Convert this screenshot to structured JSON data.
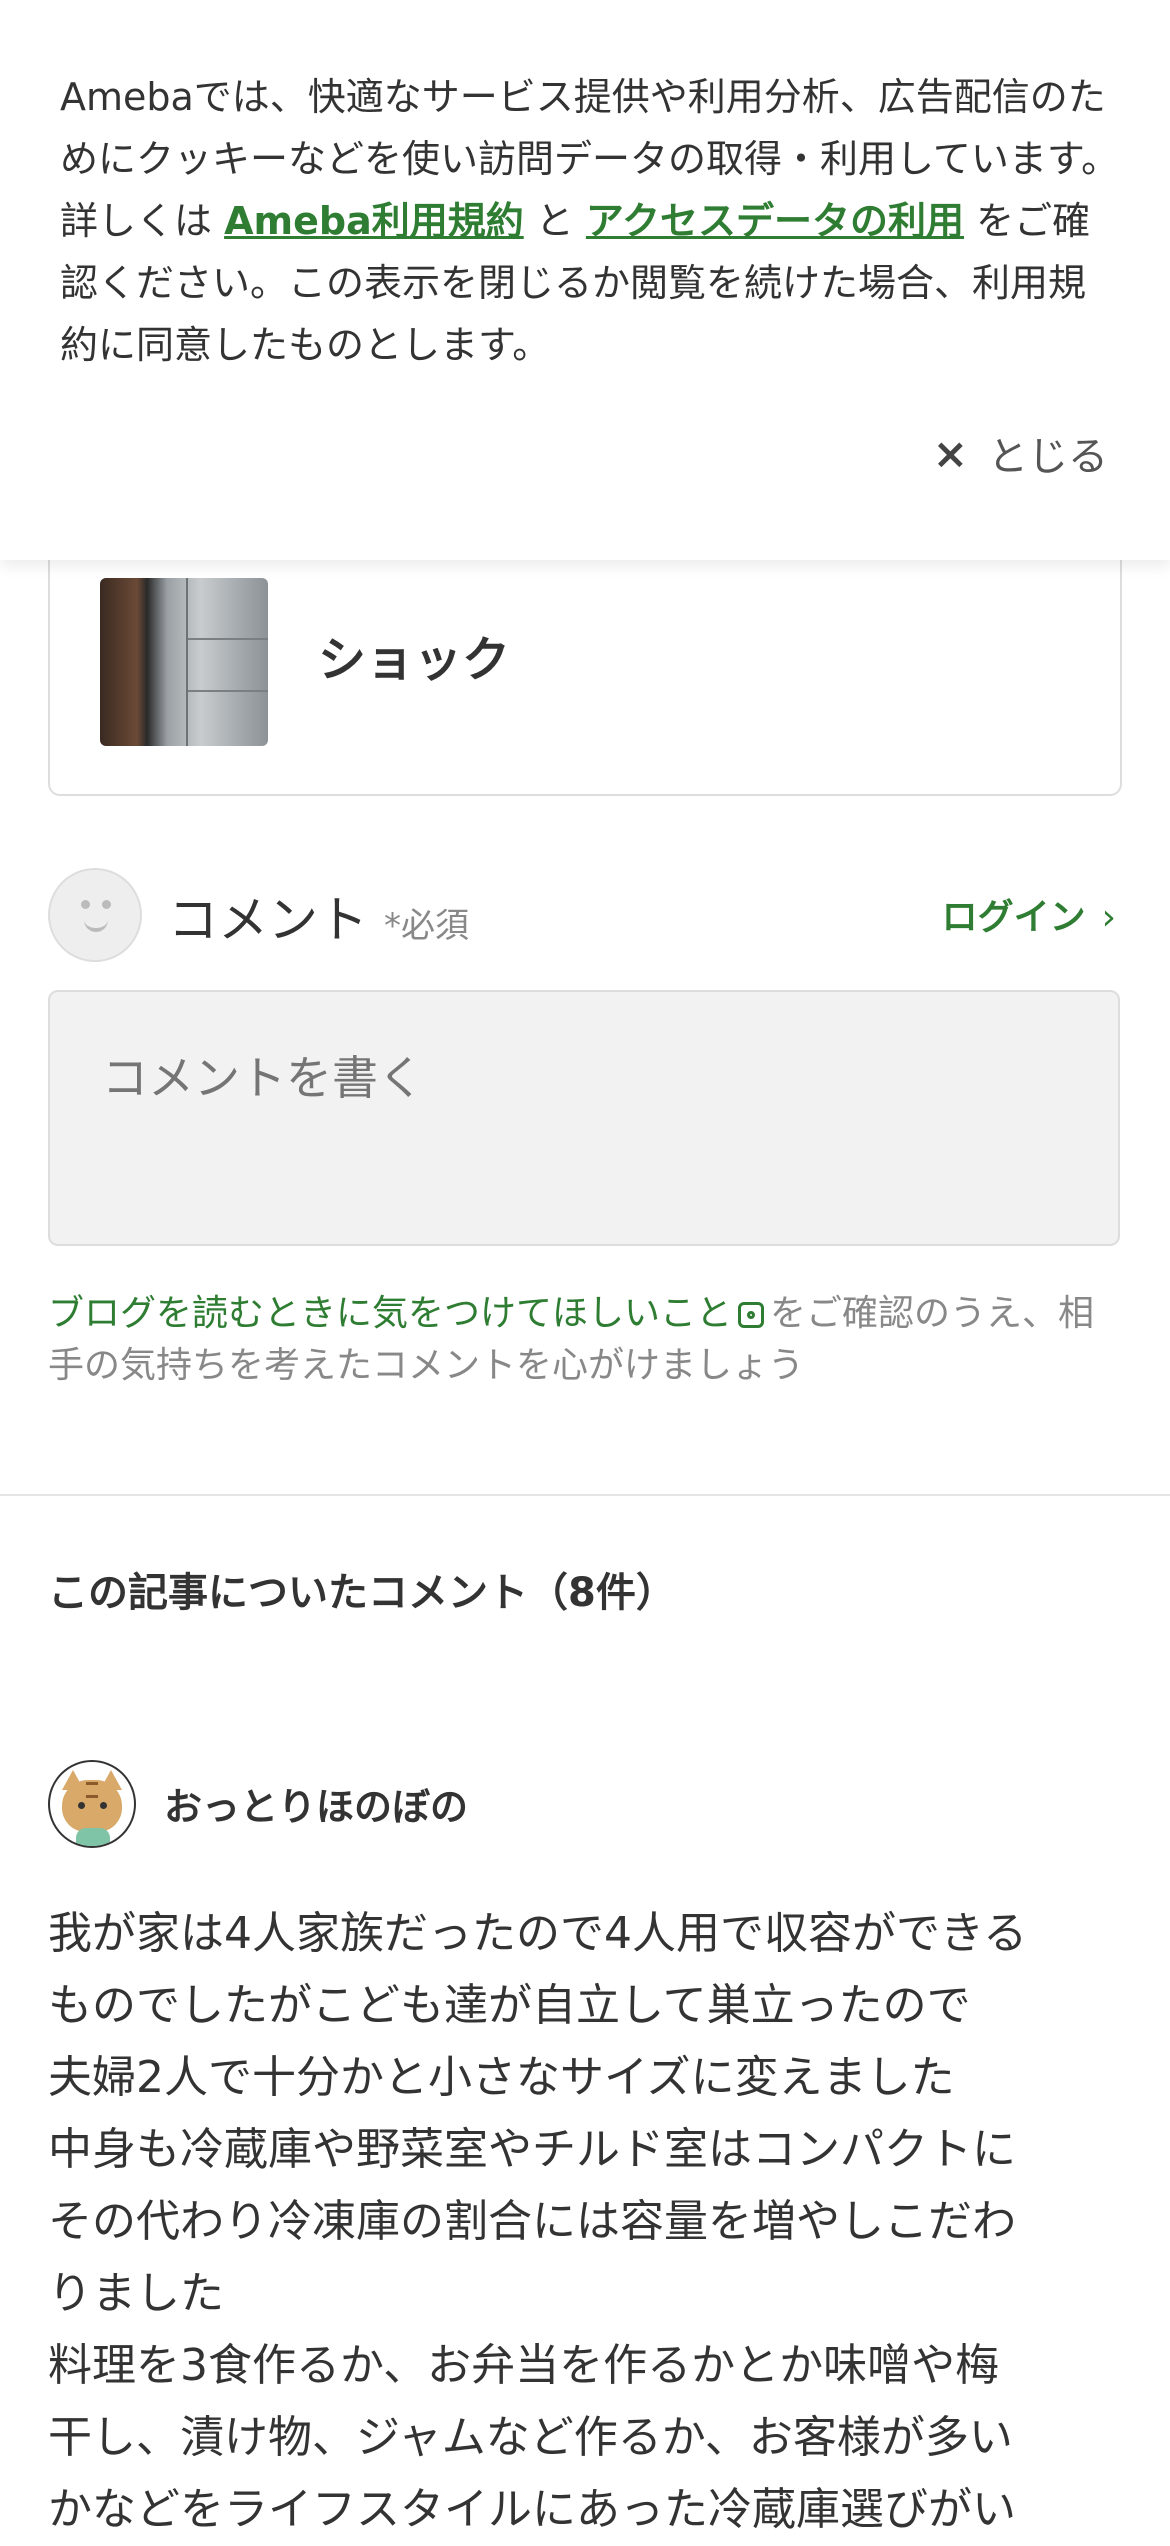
{
  "cookie_banner": {
    "text_1": "Amebaでは、快適なサービス提供や利用分析、広告配信のためにクッキーなどを使い訪問データの取得・利用しています。詳しくは ",
    "link_terms": "Ameba利用規約",
    "text_and": " と ",
    "link_access": "アクセスデータの利用",
    "text_2": " をご確認ください。この表示を閉じるか閲覧を続けた場合、利用規約に同意したものとします。",
    "close_label": "とじる",
    "close_icon": "×"
  },
  "article_card": {
    "title": "ショック"
  },
  "comment_form": {
    "label": "コメント",
    "required": "*必須",
    "login_label": "ログイン",
    "login_chevron": "›",
    "placeholder": "コメントを書く",
    "notice_link": "ブログを読むときに気をつけてほしいこと",
    "notice_text": "をご確認のうえ、相手の気持ちを考えたコメントを心がけましょう"
  },
  "comments_section": {
    "title": "この記事についたコメント（8件）",
    "comments": [
      {
        "author": "おっとりほのぼの",
        "lines": [
          "我が家は4人家族だったので4人用で収容ができる",
          "ものでしたがこども達が自立して巣立ったので",
          "夫婦2人で十分かと小さなサイズに変えました",
          "中身も冷蔵庫や野菜室やチルド室はコンパクトに",
          "その代わり冷凍庫の割合には容量を増やしこだわ",
          "りました",
          "料理を3食作るか、お弁当を作るかとか味噌や梅",
          "干し、漬け物、ジャムなど作るか、お客様が多い",
          "かなどをライフスタイルにあった冷蔵庫選びがい"
        ]
      }
    ]
  },
  "colors": {
    "accent_green": "#2e7d32",
    "text": "#333333",
    "muted": "#888888"
  }
}
